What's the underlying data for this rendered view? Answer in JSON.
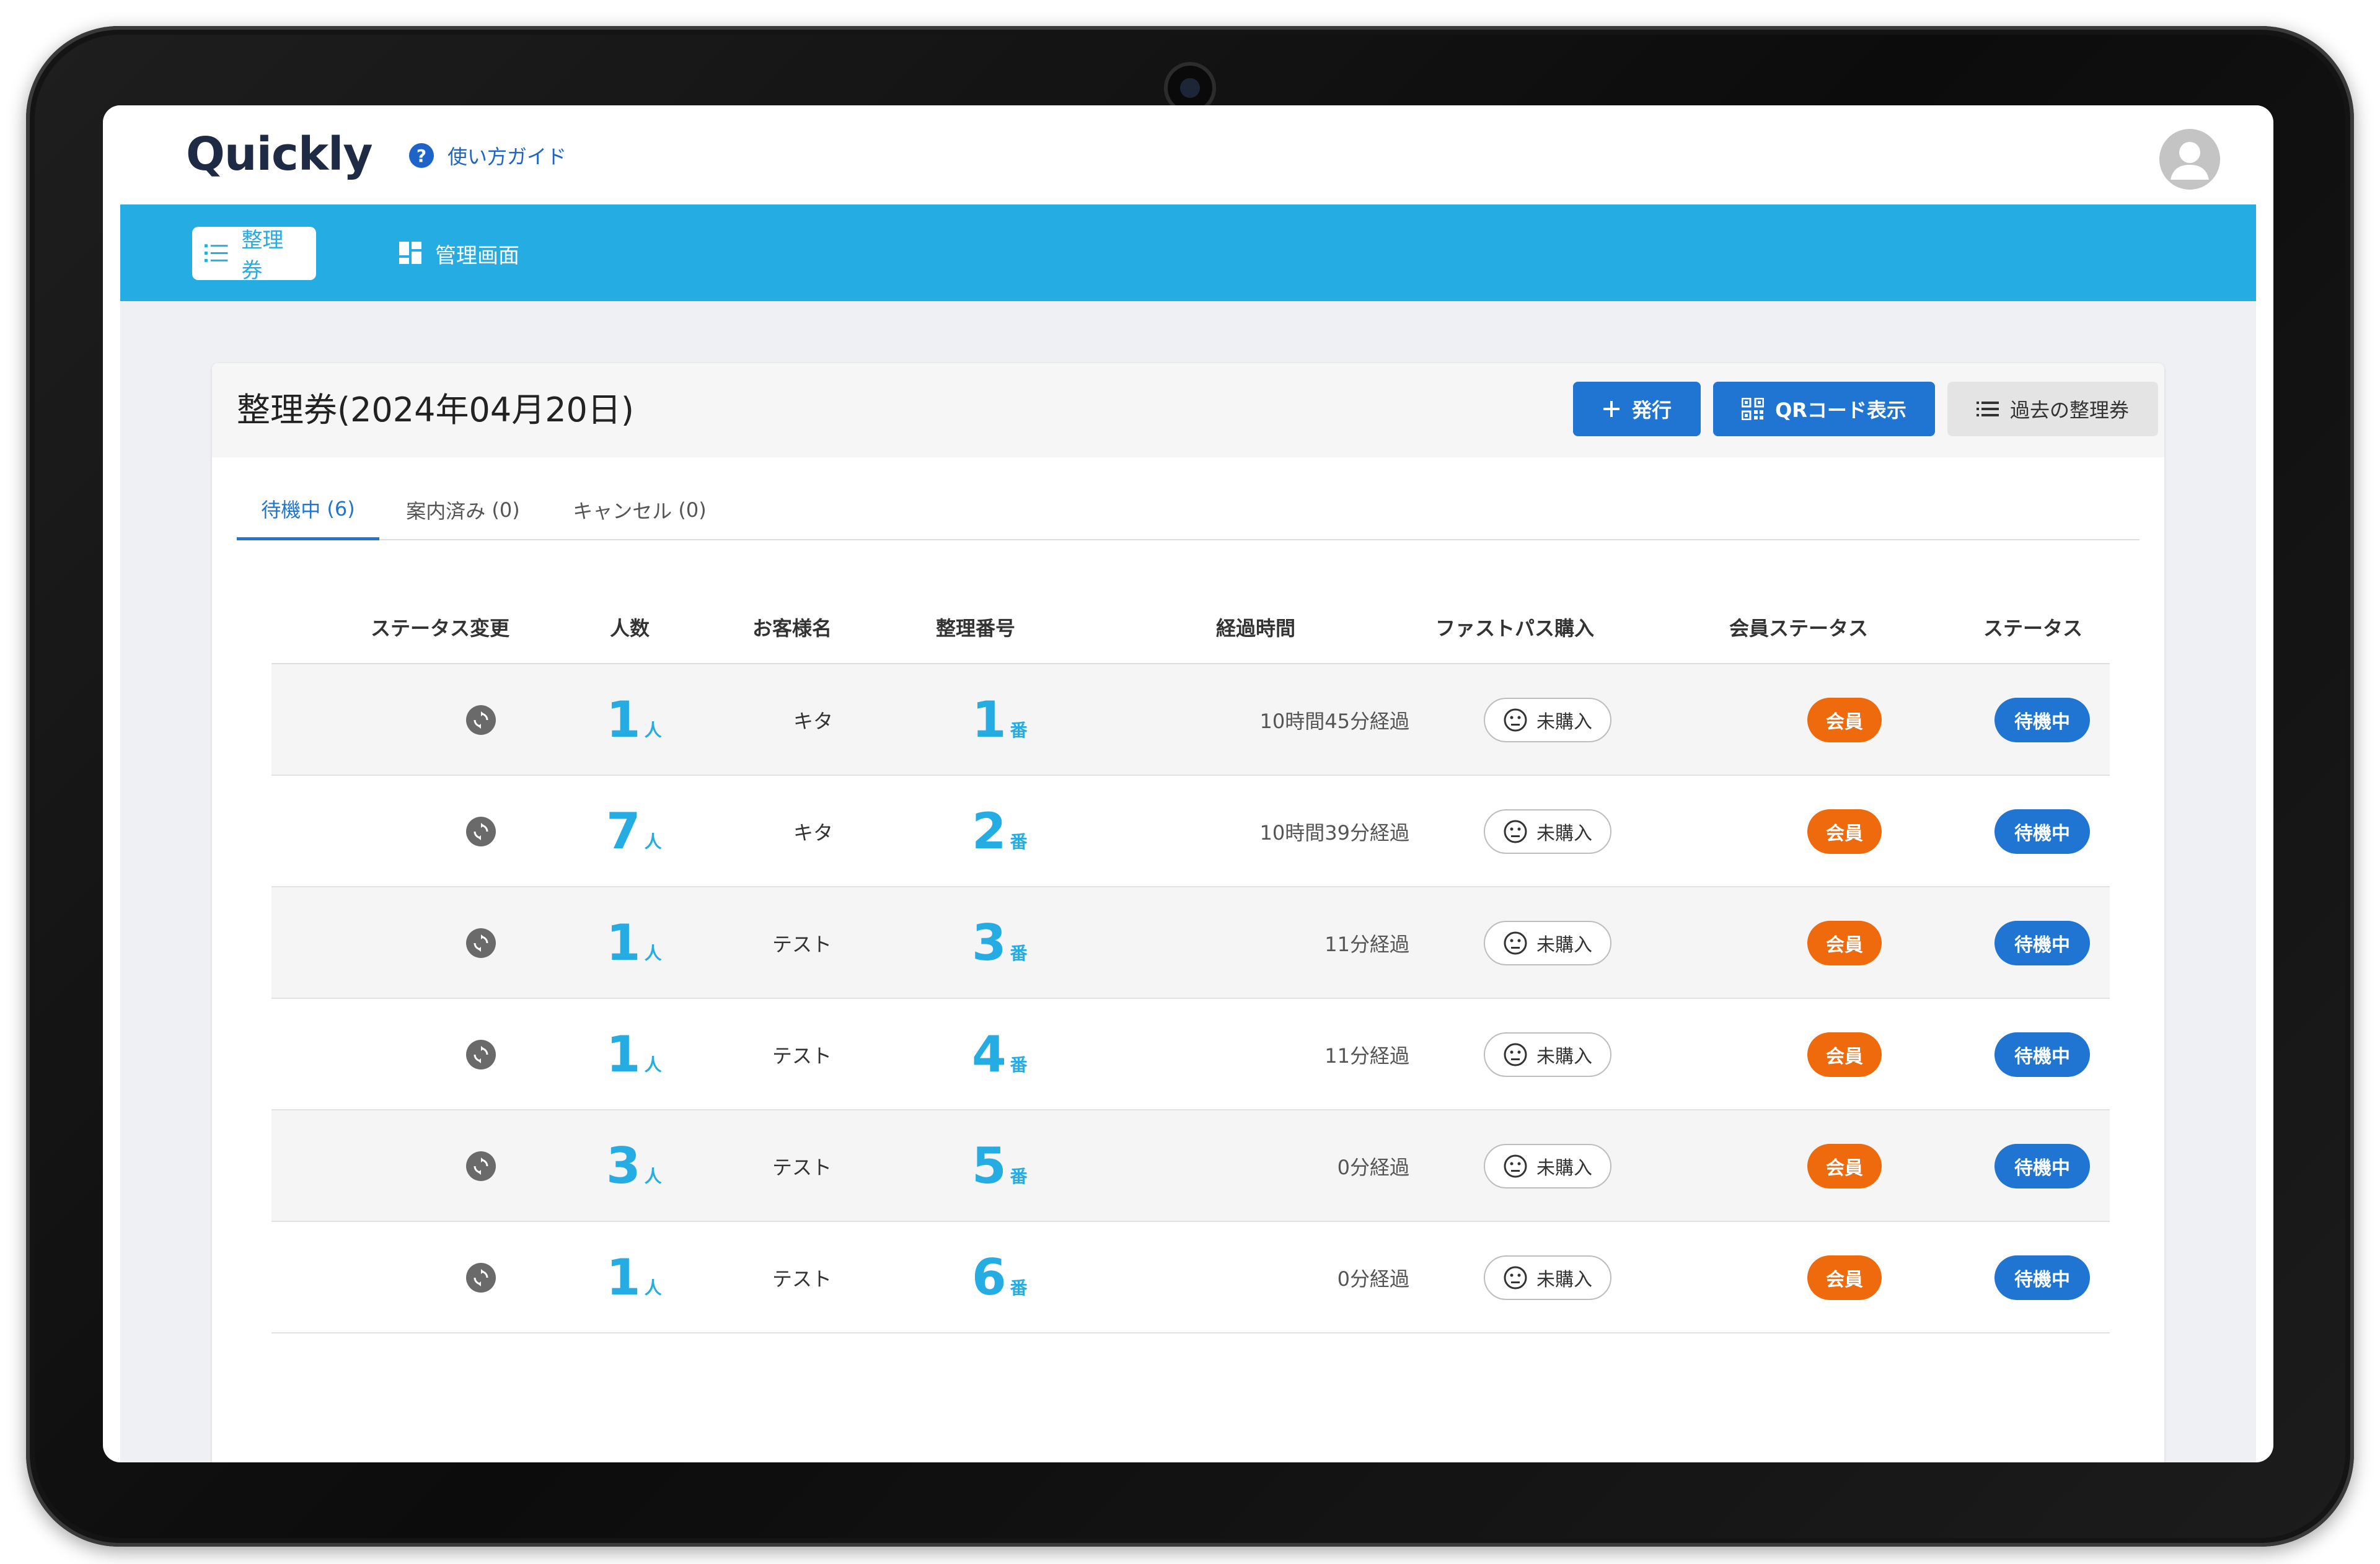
{
  "header": {
    "logo_text": "Quickly",
    "guide_label": "使い方ガイド"
  },
  "nav": {
    "tabs": [
      {
        "label": "整理券"
      },
      {
        "label": "管理画面"
      }
    ]
  },
  "card": {
    "title": "整理券(2024年04月20日)",
    "buttons": {
      "issue": "発行",
      "qr": "QRコード表示",
      "past": "過去の整理券"
    },
    "tabs": [
      {
        "label": "待機中",
        "count": "(6)"
      },
      {
        "label": "案内済み",
        "count": "(0)"
      },
      {
        "label": "キャンセル",
        "count": "(0)"
      }
    ]
  },
  "table": {
    "columns": [
      "ステータス変更",
      "人数",
      "お客様名",
      "整理番号",
      "経過時間",
      "ファストパス購入",
      "会員ステータス",
      "ステータス"
    ],
    "people_unit": "人",
    "number_unit": "番",
    "rows": [
      {
        "people": "1",
        "name": "キタ",
        "number": "1",
        "elapsed": "10時間45分経過",
        "fastpass": "未購入",
        "member": "会員",
        "status": "待機中"
      },
      {
        "people": "7",
        "name": "キタ",
        "number": "2",
        "elapsed": "10時間39分経過",
        "fastpass": "未購入",
        "member": "会員",
        "status": "待機中"
      },
      {
        "people": "1",
        "name": "テスト",
        "number": "3",
        "elapsed": "11分経過",
        "fastpass": "未購入",
        "member": "会員",
        "status": "待機中"
      },
      {
        "people": "1",
        "name": "テスト",
        "number": "4",
        "elapsed": "11分経過",
        "fastpass": "未購入",
        "member": "会員",
        "status": "待機中"
      },
      {
        "people": "3",
        "name": "テスト",
        "number": "5",
        "elapsed": "0分経過",
        "fastpass": "未購入",
        "member": "会員",
        "status": "待機中"
      },
      {
        "people": "1",
        "name": "テスト",
        "number": "6",
        "elapsed": "0分経過",
        "fastpass": "未購入",
        "member": "会員",
        "status": "待機中"
      }
    ]
  },
  "colors": {
    "nav_bg": "#25ace3",
    "primary": "#1f75d1",
    "member_badge": "#ee6a0c"
  }
}
